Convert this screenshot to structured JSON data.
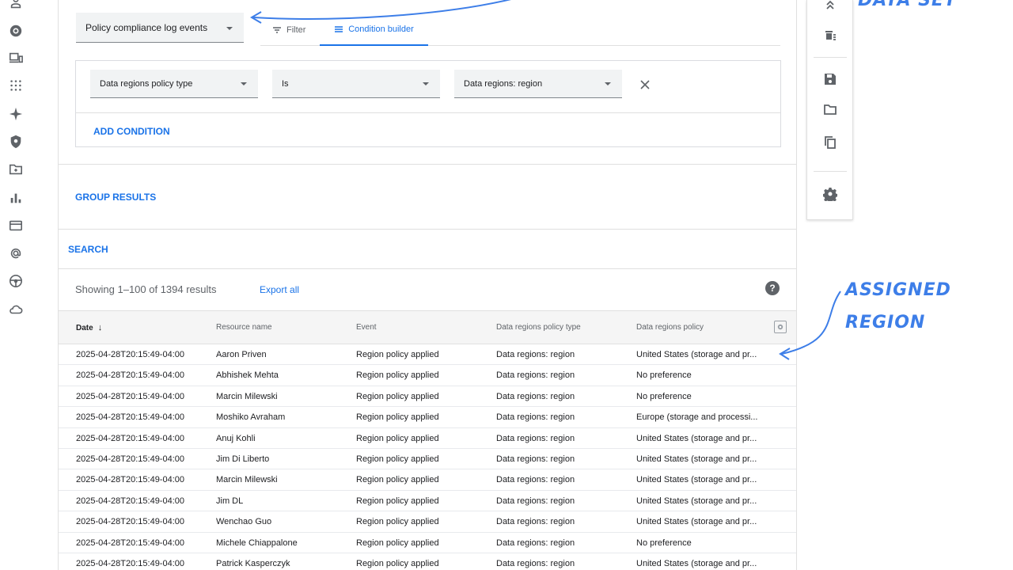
{
  "dataset": {
    "selected": "Policy compliance log events"
  },
  "tabs": [
    {
      "label": "Filter",
      "active": false
    },
    {
      "label": "Condition builder",
      "active": true
    }
  ],
  "condition": {
    "field": "Data regions policy type",
    "operator": "Is",
    "value": "Data regions: region",
    "add_label": "ADD CONDITION"
  },
  "group_results_label": "GROUP RESULTS",
  "search_label": "SEARCH",
  "results": {
    "showing": "Showing 1–100 of 1394 results",
    "export_label": "Export all",
    "help_glyph": "?"
  },
  "table": {
    "columns": [
      "Date",
      "Resource name",
      "Event",
      "Data regions policy type",
      "Data regions policy"
    ],
    "sort_glyph": "↓",
    "rows": [
      [
        "2025-04-28T20:15:49-04:00",
        "Aaron Priven",
        "Region policy applied",
        "Data regions: region",
        "United States (storage and pr..."
      ],
      [
        "2025-04-28T20:15:49-04:00",
        "Abhishek Mehta",
        "Region policy applied",
        "Data regions: region",
        "No preference"
      ],
      [
        "2025-04-28T20:15:49-04:00",
        "Marcin Milewski",
        "Region policy applied",
        "Data regions: region",
        "No preference"
      ],
      [
        "2025-04-28T20:15:49-04:00",
        "Moshiko Avraham",
        "Region policy applied",
        "Data regions: region",
        "Europe (storage and processi..."
      ],
      [
        "2025-04-28T20:15:49-04:00",
        "Anuj Kohli",
        "Region policy applied",
        "Data regions: region",
        "United States (storage and pr..."
      ],
      [
        "2025-04-28T20:15:49-04:00",
        "Jim Di Liberto",
        "Region policy applied",
        "Data regions: region",
        "United States (storage and pr..."
      ],
      [
        "2025-04-28T20:15:49-04:00",
        "Marcin Milewski",
        "Region policy applied",
        "Data regions: region",
        "United States (storage and pr..."
      ],
      [
        "2025-04-28T20:15:49-04:00",
        "Jim DL",
        "Region policy applied",
        "Data regions: region",
        "United States (storage and pr..."
      ],
      [
        "2025-04-28T20:15:49-04:00",
        "Wenchao Guo",
        "Region policy applied",
        "Data regions: region",
        "United States (storage and pr..."
      ],
      [
        "2025-04-28T20:15:49-04:00",
        "Michele Chiappalone",
        "Region policy applied",
        "Data regions: region",
        "No preference"
      ],
      [
        "2025-04-28T20:15:49-04:00",
        "Patrick Kasperczyk",
        "Region policy applied",
        "Data regions: region",
        "United States (storage and pr..."
      ]
    ]
  },
  "annotations": {
    "dataset": "DATA SET",
    "region_line1": "ASSIGNED",
    "region_line2": "REGION",
    "color": "#3d7ee8"
  },
  "colors": {
    "accent": "#1a73e8",
    "field_bg": "#f1f3f4",
    "header_bg": "#f5f5f5"
  },
  "icons": {
    "rail": [
      "user-icon",
      "chrome-icon",
      "devices-icon",
      "apps-grid-icon",
      "sparkle-icon",
      "shield-icon",
      "folder-icon",
      "bar-chart-icon",
      "credit-card-icon",
      "at-sign-icon",
      "steering-wheel-icon",
      "cloud-icon"
    ],
    "toolbar": [
      "collapse-icon",
      "clear-filter-icon",
      "save-icon",
      "folder-open-icon",
      "copy-icon",
      "settings-icon"
    ]
  }
}
